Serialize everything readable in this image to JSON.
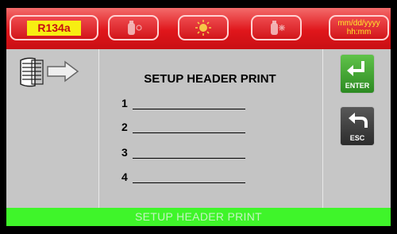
{
  "topbar": {
    "refrigerant_label": "R134a",
    "datetime_line1": "mm/dd/yyyy",
    "datetime_line2": "hh:mm",
    "icons": [
      "gas-cylinder-icon",
      "sun-icon",
      "gas-cylinder-snow-icon"
    ]
  },
  "main": {
    "title": "SETUP HEADER PRINT",
    "lines": [
      {
        "number": "1",
        "value": ""
      },
      {
        "number": "2",
        "value": ""
      },
      {
        "number": "3",
        "value": ""
      },
      {
        "number": "4",
        "value": ""
      }
    ]
  },
  "sidebar_right": {
    "enter_label": "ENTER",
    "esc_label": "ESC"
  },
  "status_bar": {
    "text": "SETUP HEADER PRINT"
  },
  "colors": {
    "topbar": "#e0161b",
    "refrigerant_chip": "#f7ee12",
    "status_bar": "#3ff52a",
    "enter_button": "#2c8a22",
    "esc_button": "#2c2c2c"
  }
}
